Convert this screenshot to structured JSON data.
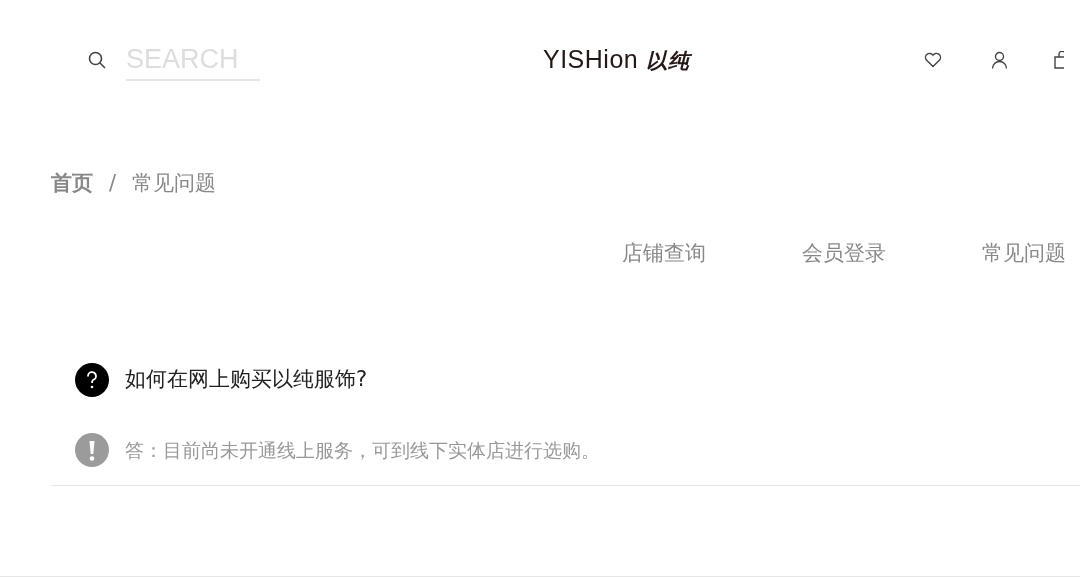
{
  "header": {
    "search": {
      "placeholder": "SEARCH"
    },
    "logo": {
      "latin": "YISHion",
      "chinese": "以纯"
    }
  },
  "breadcrumb": [
    {
      "label": "首页",
      "current": false
    },
    {
      "label": "常见问题",
      "current": true
    }
  ],
  "breadcrumb_separator": "/",
  "nav": [
    {
      "label": "店铺查询"
    },
    {
      "label": "会员登录"
    },
    {
      "label": "常见问题"
    }
  ],
  "faq": [
    {
      "question": "如何在网上购买以纯服饰?",
      "answer": "答：目前尚未开通线上服务，可到线下实体店进行选购。"
    }
  ]
}
